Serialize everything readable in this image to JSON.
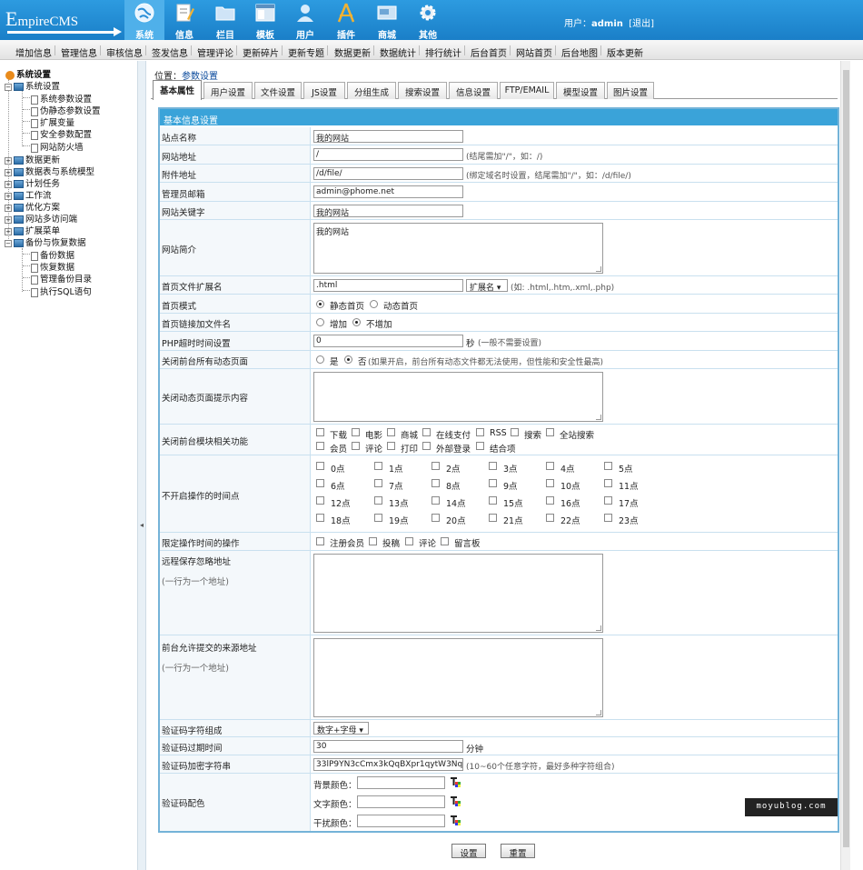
{
  "logo": {
    "big_e": "E",
    "rest": "mpireCMS"
  },
  "topnav": [
    {
      "label": "系统",
      "icon": "globe-icon",
      "active": true
    },
    {
      "label": "信息",
      "icon": "document-pen-icon",
      "active": false
    },
    {
      "label": "栏目",
      "icon": "folder-icon",
      "active": false
    },
    {
      "label": "模板",
      "icon": "template-window-icon",
      "active": false
    },
    {
      "label": "用户",
      "icon": "user-icon",
      "active": false
    },
    {
      "label": "插件",
      "icon": "compass-tools-icon",
      "active": false
    },
    {
      "label": "商城",
      "icon": "shop-card-icon",
      "active": false
    },
    {
      "label": "其他",
      "icon": "gear-icon",
      "active": false
    }
  ],
  "user": {
    "prefix": "用户：",
    "name": "admin",
    "logout": "[退出]"
  },
  "menubar": [
    "增加信息",
    "管理信息",
    "审核信息",
    "签发信息",
    "管理评论",
    "更新碎片",
    "更新专题",
    "数据更新",
    "数据统计",
    "排行统计",
    "后台首页",
    "网站首页",
    "后台地图",
    "版本更新"
  ],
  "sidebar": {
    "root": "系统设置",
    "group1": "系统设置",
    "group1_items": [
      "系统参数设置",
      "伪静态参数设置",
      "扩展变量",
      "安全参数配置",
      "网站防火墙"
    ],
    "groups": [
      "数据更新",
      "数据表与系统模型",
      "计划任务",
      "工作流",
      "优化方案",
      "网站多访问端",
      "扩展菜单"
    ],
    "group_last": "备份与恢复数据",
    "group_last_items": [
      "备份数据",
      "恢复数据",
      "管理备份目录",
      "执行SQL语句"
    ]
  },
  "divider_arrow": "◂",
  "position": {
    "prefix": "位置：",
    "link": "参数设置"
  },
  "tabs": [
    "基本属性",
    "用户设置",
    "文件设置",
    "JS设置",
    "分组生成",
    "搜索设置",
    "信息设置",
    "FTP/EMAIL",
    "模型设置",
    "图片设置"
  ],
  "form": {
    "header": "基本信息设置",
    "site_name": {
      "label": "站点名称",
      "value": "我的网站"
    },
    "site_url": {
      "label": "网站地址",
      "value": "/",
      "note": "(结尾需加\"/\"，如：/)"
    },
    "attach_url": {
      "label": "附件地址",
      "value": "/d/file/",
      "note": "(绑定域名时设置，结尾需加\"/\"，如：/d/file/)"
    },
    "admin_email": {
      "label": "管理员邮箱",
      "value": "admin@phome.net"
    },
    "keywords": {
      "label": "网站关键字",
      "value": "我的网站"
    },
    "intro": {
      "label": "网站简介",
      "value": "我的网站"
    },
    "index_ext": {
      "label": "首页文件扩展名",
      "value": ".html",
      "select": "扩展名",
      "note": "(如: .html,.htm,.xml,.php)"
    },
    "index_mode": {
      "label": "首页模式",
      "opt1": "静态首页",
      "opt2": "动态首页"
    },
    "index_link": {
      "label": "首页链接加文件名",
      "opt1": "增加",
      "opt2": "不增加"
    },
    "php_timeout": {
      "label": "PHP超时时间设置",
      "value": "0",
      "unit": "秒",
      "note": "(一般不需要设置)"
    },
    "close_dynamic": {
      "label": "关闭前台所有动态页面",
      "opt1": "是",
      "opt2": "否",
      "note": "(如果开启，前台所有动态文件都无法使用，但性能和安全性最高)"
    },
    "close_msg": {
      "label": "关闭动态页面提示内容",
      "value": ""
    },
    "close_modules": {
      "label": "关闭前台模块相关功能",
      "row1": [
        "下载",
        "电影",
        "商城",
        "在线支付",
        "RSS",
        "搜索",
        "全站搜索"
      ],
      "row2": [
        "会员",
        "评论",
        "打印",
        "外部登录",
        "结合项"
      ]
    },
    "hours": {
      "label": "不开启操作的时间点",
      "items": [
        "0点",
        "1点",
        "2点",
        "3点",
        "4点",
        "5点",
        "6点",
        "7点",
        "8点",
        "9点",
        "10点",
        "11点",
        "12点",
        "13点",
        "14点",
        "15点",
        "16点",
        "17点",
        "18点",
        "19点",
        "20点",
        "21点",
        "22点",
        "23点"
      ]
    },
    "limit_ops": {
      "label": "限定操作时间的操作",
      "items": [
        "注册会员",
        "投稿",
        "评论",
        "留言板"
      ]
    },
    "remote_ignore": {
      "label": "远程保存忽略地址",
      "sub": "(一行为一个地址)",
      "value": ""
    },
    "allowed_src": {
      "label": "前台允许提交的来源地址",
      "sub": "(一行为一个地址)",
      "value": ""
    },
    "captcha_chars": {
      "label": "验证码字符组成",
      "select": "数字+字母"
    },
    "captcha_expire": {
      "label": "验证码过期时间",
      "value": "30",
      "unit": "分钟"
    },
    "captcha_key": {
      "label": "验证码加密字符串",
      "value": "33lP9YN3cCmx3kQqBXpr1qytW3Nqh4",
      "note": "(10~60个任意字符，最好多种字符组合)"
    },
    "captcha_colors": {
      "label": "验证码配色",
      "bg": "背景颜色：",
      "fg": "文字颜色：",
      "noise": "干扰颜色："
    }
  },
  "buttons": {
    "submit": "设置",
    "reset": "重置"
  },
  "watermark": "moyublog.com"
}
